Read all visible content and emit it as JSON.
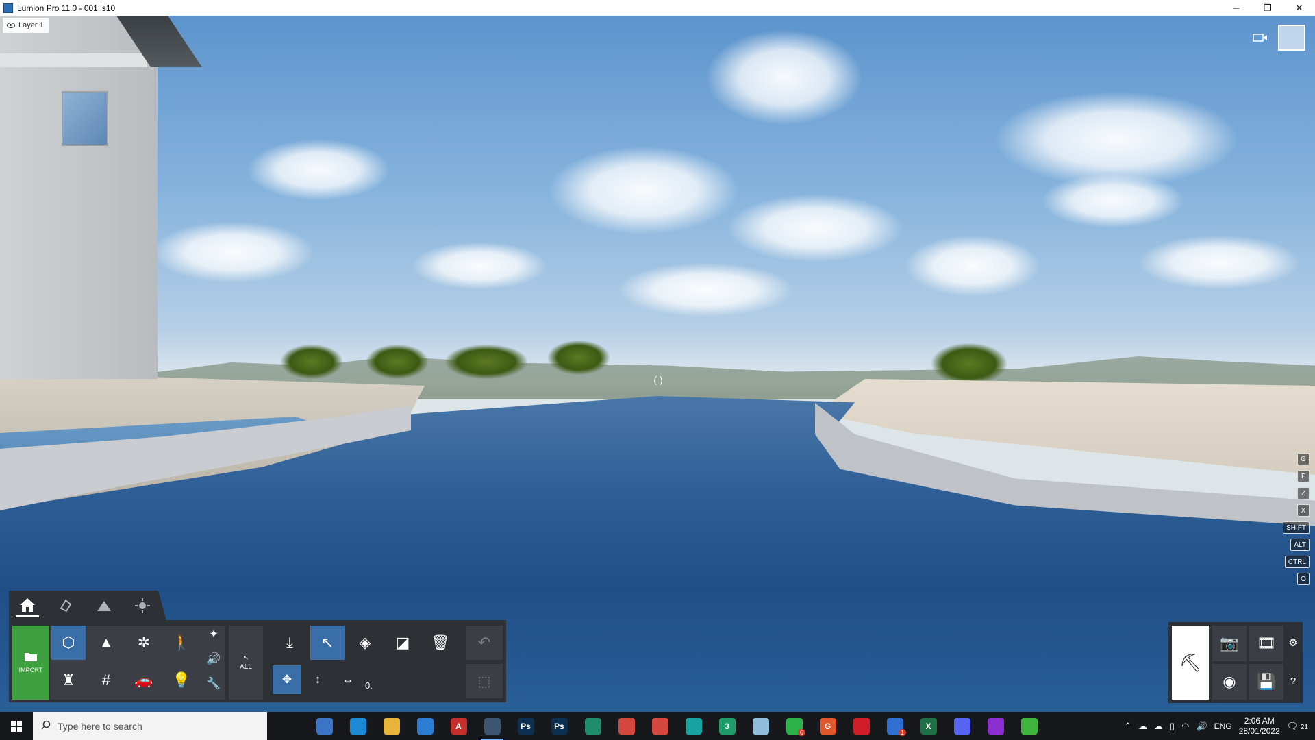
{
  "window": {
    "title": "Lumion Pro 11.0  - 001.ls10",
    "controls": [
      "─",
      "❐",
      "✕"
    ]
  },
  "viewport": {
    "layer_label": "Layer 1",
    "crosshair": "( )",
    "keys": [
      "G",
      "F",
      "Z",
      "X",
      "SHIFT",
      "ALT",
      "CTRL",
      "O"
    ]
  },
  "toolbar": {
    "mode_tabs": [
      "home-icon",
      "material-icon",
      "landscape-icon",
      "weather-icon"
    ],
    "import_label": "IMPORT",
    "all_label": "ALL",
    "value_field": "0.",
    "colors": {
      "panel": "#2d3035",
      "import": "#3ea13f",
      "highlight": "#3a6ea8"
    }
  },
  "right_panel": {
    "build_icon": "build-mode-icon",
    "photo_icon": "camera-icon",
    "movie_icon": "film-icon",
    "panorama_icon": "360-icon",
    "save_icon": "save-icon",
    "settings_icon": "gear-icon",
    "help_icon": "help-icon"
  },
  "taskbar": {
    "search_placeholder": "Type here to search",
    "apps": [
      {
        "name": "task-view",
        "label": "",
        "color": "#17181b"
      },
      {
        "name": "calculator",
        "label": "",
        "color": "#3b74c4"
      },
      {
        "name": "edge",
        "label": "",
        "color": "#1e8ad6"
      },
      {
        "name": "file-explorer",
        "label": "",
        "color": "#e8b43a"
      },
      {
        "name": "app-blue",
        "label": "",
        "color": "#2b7dd1"
      },
      {
        "name": "autocad",
        "label": "A",
        "color": "#c4302b"
      },
      {
        "name": "lumion",
        "label": "",
        "color": "#3b5570"
      },
      {
        "name": "photoshop-1",
        "label": "Ps",
        "color": "#0c2e4f"
      },
      {
        "name": "photoshop-2",
        "label": "Ps",
        "color": "#0c2e4f"
      },
      {
        "name": "app-green-1",
        "label": "",
        "color": "#1f8c6b"
      },
      {
        "name": "chrome-1",
        "label": "",
        "color": "#d4483d"
      },
      {
        "name": "chrome-2",
        "label": "",
        "color": "#d4483d"
      },
      {
        "name": "app-teal",
        "label": "",
        "color": "#19a3a0"
      },
      {
        "name": "app-3",
        "label": "3",
        "color": "#1f9c6b"
      },
      {
        "name": "app-paper",
        "label": "",
        "color": "#8fbcd8"
      },
      {
        "name": "whatsapp",
        "label": "",
        "color": "#2bb34a",
        "badge": "6"
      },
      {
        "name": "grammarly",
        "label": "G",
        "color": "#e0572b"
      },
      {
        "name": "opera",
        "label": "",
        "color": "#d11d2a"
      },
      {
        "name": "app-check",
        "label": "",
        "color": "#2f6fd1",
        "badge": "1"
      },
      {
        "name": "excel",
        "label": "X",
        "color": "#1e7145"
      },
      {
        "name": "discord",
        "label": "",
        "color": "#5865f2"
      },
      {
        "name": "app-purple",
        "label": "",
        "color": "#8b2fd1"
      },
      {
        "name": "app-green-2",
        "label": "",
        "color": "#3db53f"
      }
    ],
    "tray": {
      "language": "ENG",
      "time": "2:06 AM",
      "date": "28/01/2022",
      "notifications": "21"
    }
  }
}
